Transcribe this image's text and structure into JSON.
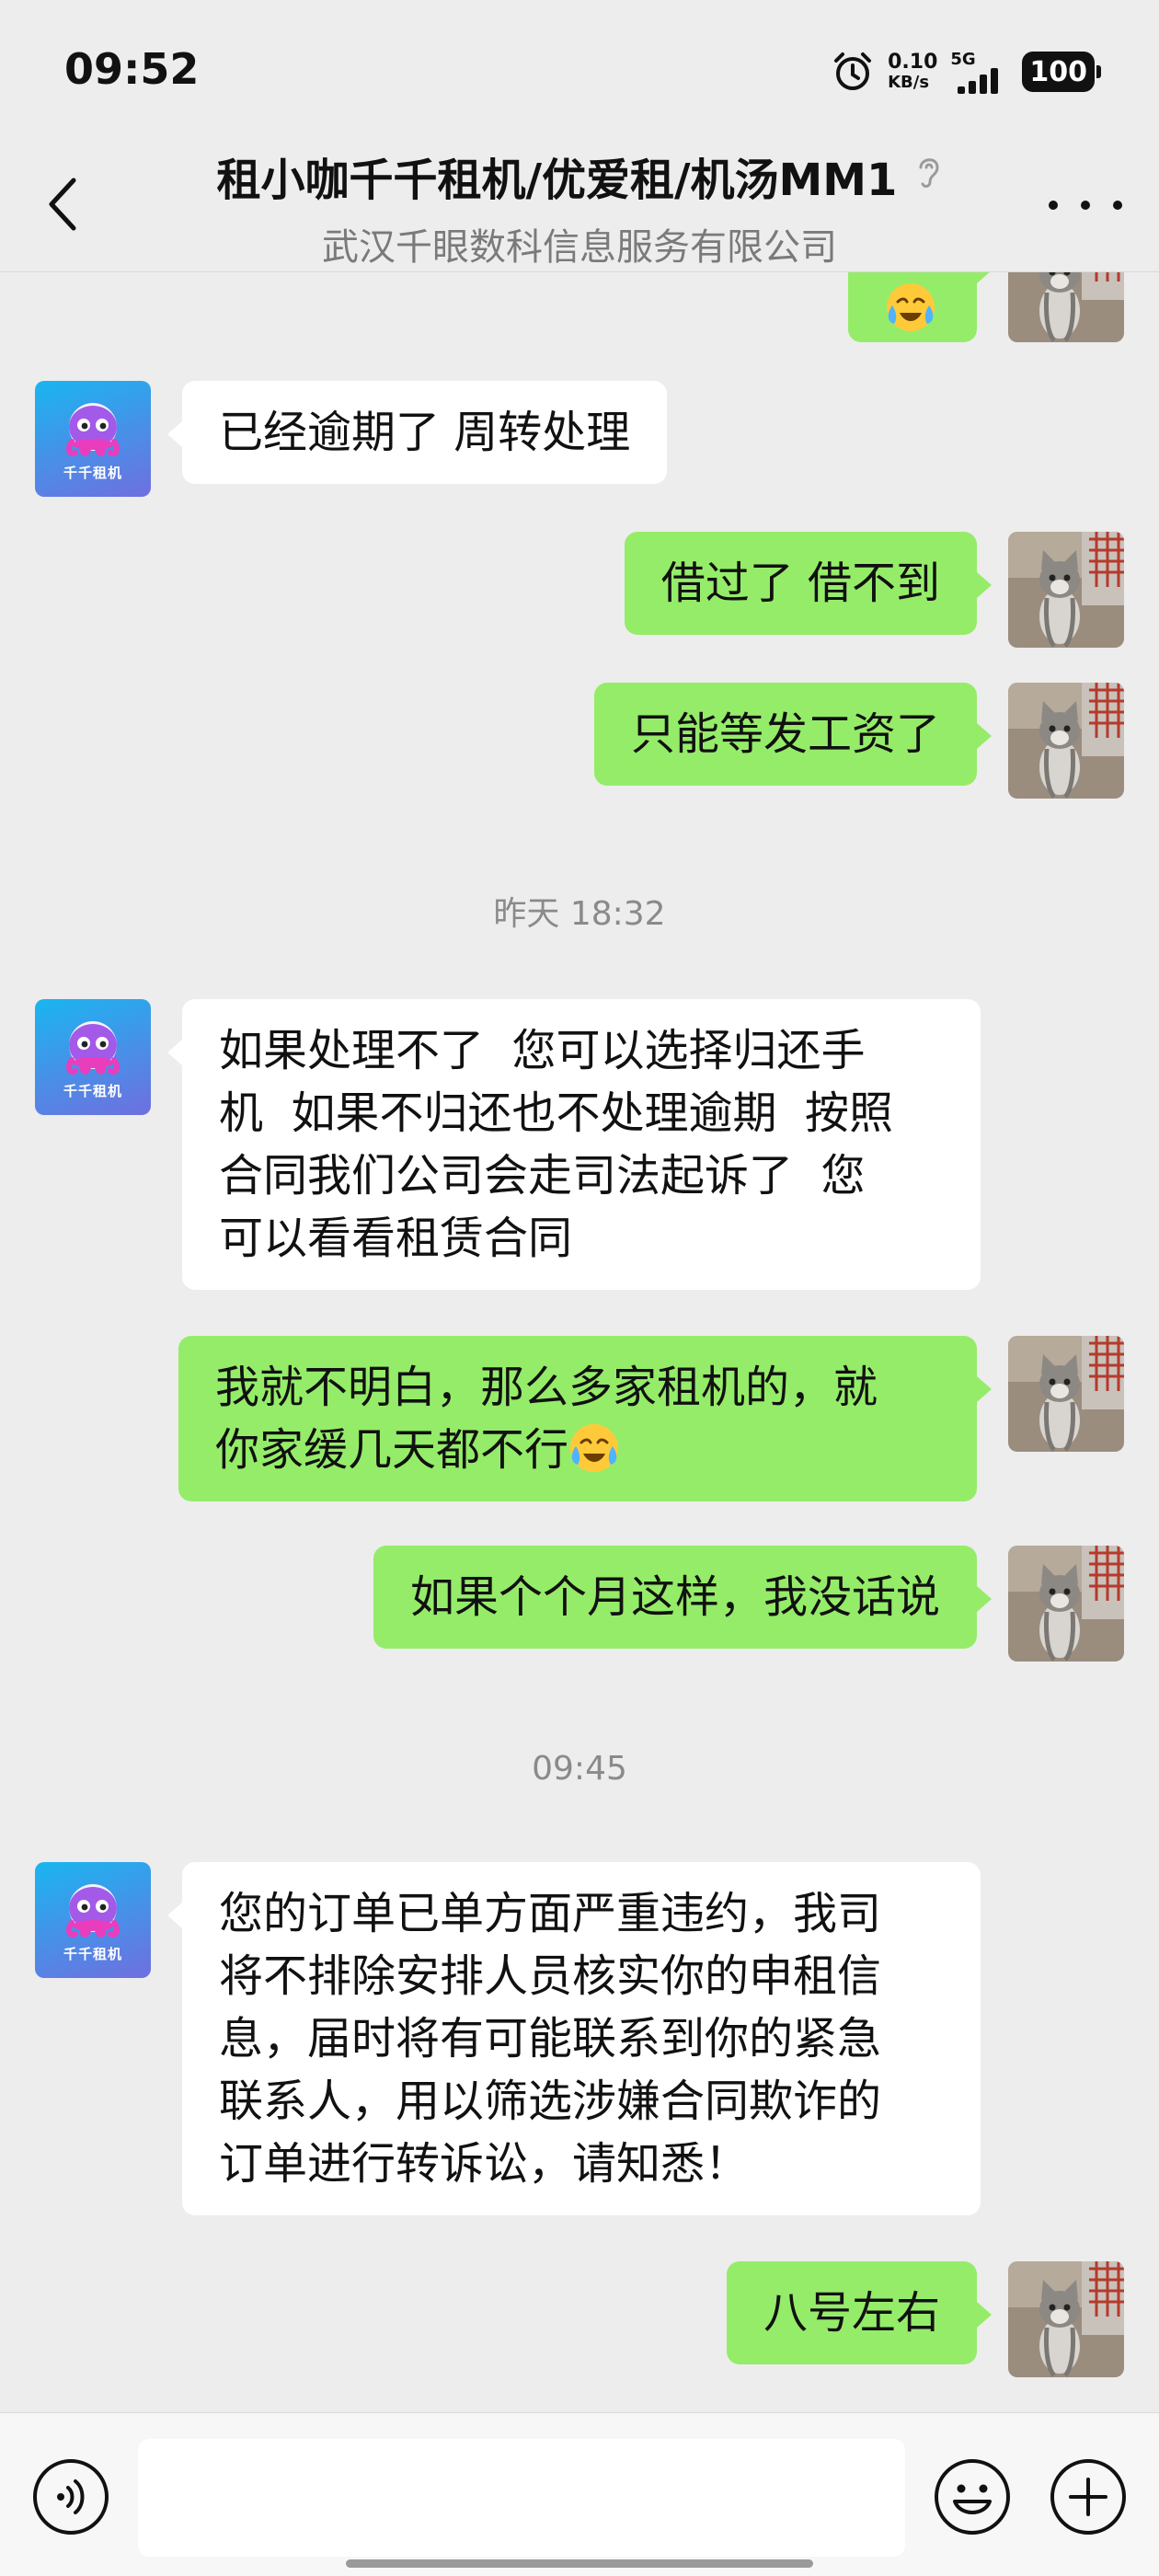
{
  "status_bar": {
    "time": "09:52",
    "net_speed_value": "0.10",
    "net_speed_unit": "KB/s",
    "network_type": "5G",
    "battery": "100"
  },
  "header": {
    "title": "租小咖千千租机/优爱租/机汤MM1",
    "subtitle": "武汉千眼数科信息服务有限公司"
  },
  "bot_avatar": {
    "brand": "千千租机"
  },
  "messages": {
    "m1": "已经逾期了 周转处理",
    "m2": "借过了 借不到",
    "m3": "只能等发工资了",
    "ts1": "昨天 18:32",
    "m4_l1": "如果处理不了  您可以选择归还手",
    "m4_l2": "机  如果不归还也不处理逾期  按照",
    "m4_l3": "合同我们公司会走司法起诉了  您",
    "m4_l4": "可以看看租赁合同",
    "m5_l1": "我就不明白，那么多家租机的，就",
    "m5_l2": "你家缓几天都不行",
    "m6": "如果个个月这样，我没话说",
    "ts2": "09:45",
    "m7_l1": "您的订单已单方面严重违约，我司",
    "m7_l2": "将不排除安排人员核实你的申租信",
    "m7_l3": "息，届时将有可能联系到你的紧急",
    "m7_l4": "联系人，用以筛选涉嫌合同欺诈的",
    "m7_l5": "订单进行转诉讼，请知悉！",
    "m8": "八号左右"
  },
  "colors": {
    "background": "#ededed",
    "bubble_sent": "#95ec69",
    "bubble_received": "#ffffff"
  },
  "icons": {
    "back": "chevron-left-icon",
    "earpiece": "ear-icon",
    "more": "more-dots-icon",
    "voice": "voice-icon",
    "emoji": "smiley-icon",
    "plus": "plus-icon"
  }
}
